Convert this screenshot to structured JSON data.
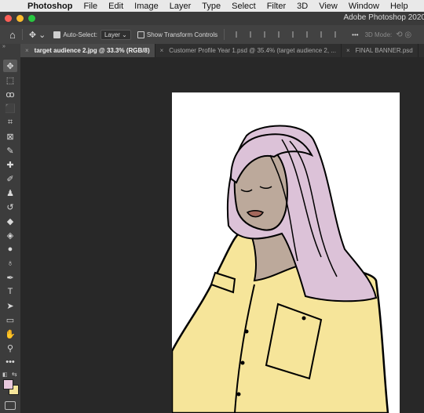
{
  "menubar": {
    "app_name": "Photoshop",
    "items": [
      "File",
      "Edit",
      "Image",
      "Layer",
      "Type",
      "Select",
      "Filter",
      "3D",
      "View",
      "Window",
      "Help"
    ]
  },
  "titlebar": {
    "title": "Adobe Photoshop 2020"
  },
  "options": {
    "auto_select_label": "Auto-Select:",
    "auto_select_value": "Layer",
    "show_transform_label": "Show Transform Controls",
    "more_glyph": "•••",
    "mode_label": "3D Mode:"
  },
  "tabs": [
    {
      "label": "target audience 2.jpg @ 33.3% (RGB/8)",
      "active": true
    },
    {
      "label": "Customer Profile Year 1.psd @ 35.4% (target audience 2, ...",
      "active": false
    },
    {
      "label": "FINAL BANNER.psd",
      "active": false
    }
  ],
  "tools": [
    {
      "name": "move",
      "glyph": "✥"
    },
    {
      "name": "marquee",
      "glyph": "⬚"
    },
    {
      "name": "lasso",
      "glyph": "ꝏ"
    },
    {
      "name": "object-select",
      "glyph": "⬛"
    },
    {
      "name": "crop",
      "glyph": "⌗"
    },
    {
      "name": "frame",
      "glyph": "⊠"
    },
    {
      "name": "eyedropper",
      "glyph": "✎"
    },
    {
      "name": "healing",
      "glyph": "✚"
    },
    {
      "name": "brush",
      "glyph": "✐"
    },
    {
      "name": "stamp",
      "glyph": "♟"
    },
    {
      "name": "history-brush",
      "glyph": "↺"
    },
    {
      "name": "eraser",
      "glyph": "◆"
    },
    {
      "name": "paint-bucket",
      "glyph": "◈"
    },
    {
      "name": "blur",
      "glyph": "●"
    },
    {
      "name": "dodge",
      "glyph": "♁"
    },
    {
      "name": "pen",
      "glyph": "✒"
    },
    {
      "name": "type",
      "glyph": "T"
    },
    {
      "name": "path-select",
      "glyph": "➤"
    },
    {
      "name": "rectangle",
      "glyph": "▭"
    },
    {
      "name": "hand",
      "glyph": "✋"
    },
    {
      "name": "zoom",
      "glyph": "⚲"
    },
    {
      "name": "edit-toolbar",
      "glyph": "•••"
    }
  ],
  "colors": {
    "foreground": "#e8c7dc",
    "background": "#f6e59a",
    "hair": "#dcc2d8",
    "skin": "#bca99b",
    "shirt": "#f6e59a",
    "lips": "#a4685c"
  }
}
